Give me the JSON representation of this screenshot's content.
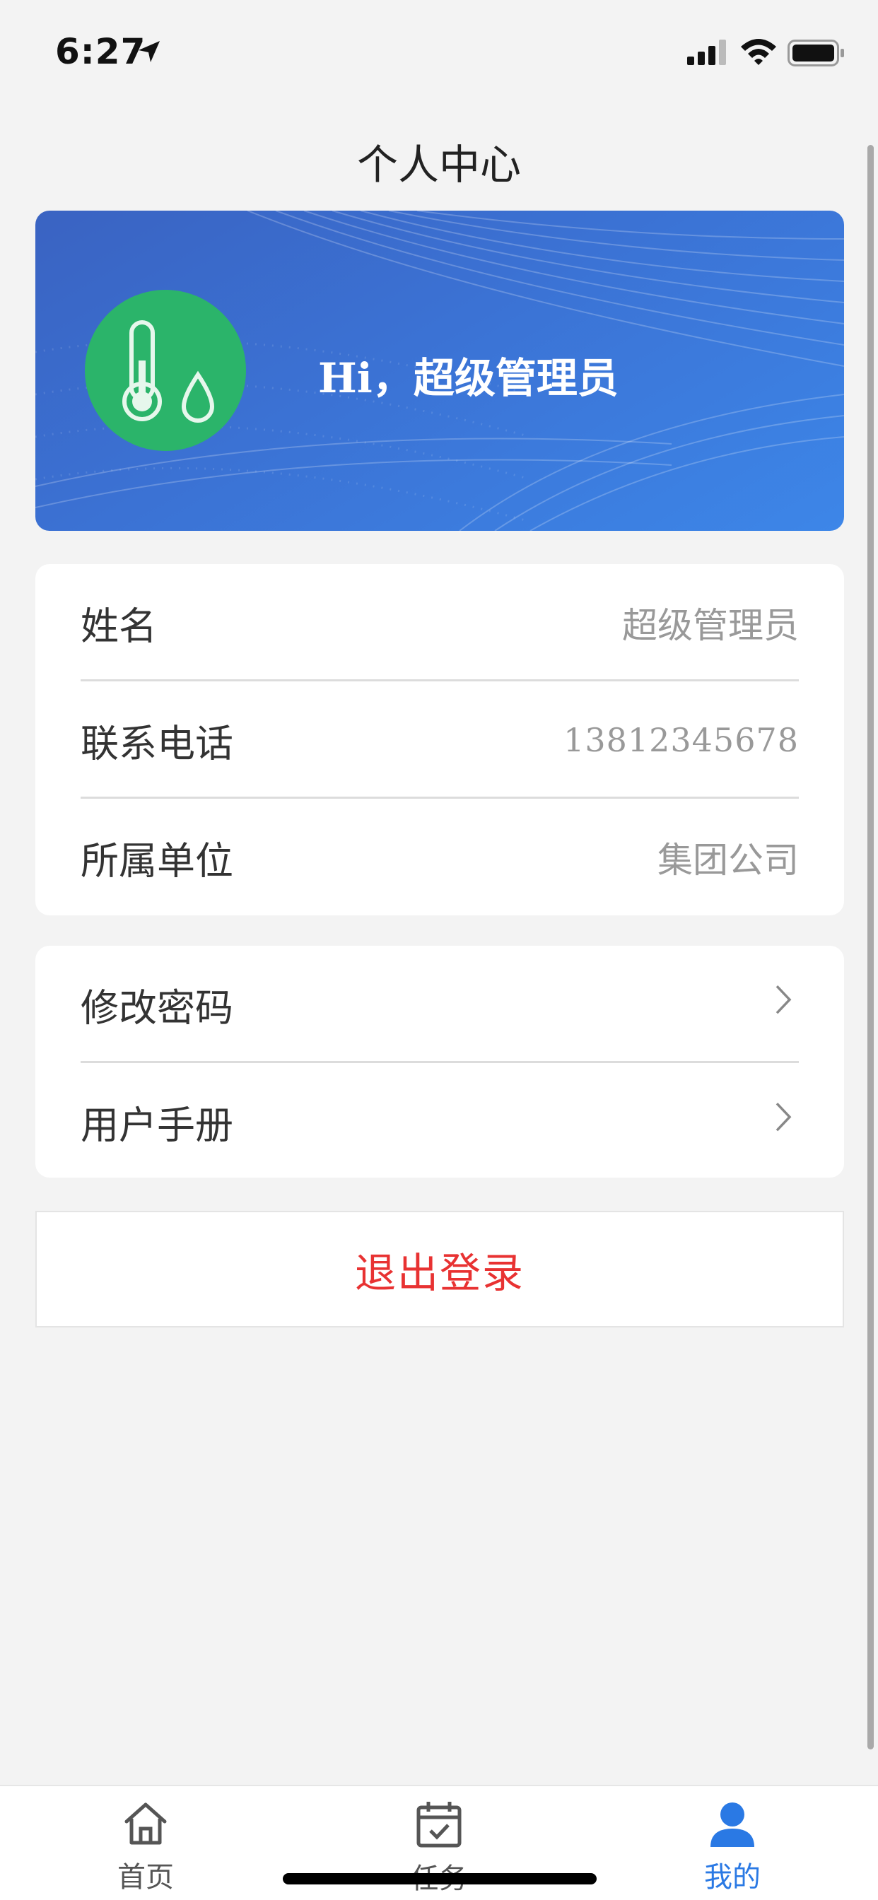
{
  "status_bar": {
    "time": "6:27"
  },
  "header": {
    "title": "个人中心"
  },
  "profile": {
    "greeting": "Hi，超级管理员"
  },
  "info": {
    "rows": [
      {
        "label": "姓名",
        "value": "超级管理员"
      },
      {
        "label": "联系电话",
        "value": "13812345678"
      },
      {
        "label": "所属单位",
        "value": "集团公司"
      }
    ]
  },
  "actions": {
    "items": [
      {
        "label": "修改密码"
      },
      {
        "label": "用户手册"
      }
    ]
  },
  "logout": {
    "label": "退出登录"
  },
  "tabbar": {
    "tabs": [
      {
        "label": "首页",
        "icon": "home-icon"
      },
      {
        "label": "任务",
        "icon": "calendar-check-icon"
      },
      {
        "label": "我的",
        "icon": "user-icon",
        "active": true
      }
    ],
    "active_color": "#2a79e4"
  },
  "colors": {
    "banner": "#3b72d4",
    "avatar": "#2bb46a",
    "logout": "#e83232"
  }
}
